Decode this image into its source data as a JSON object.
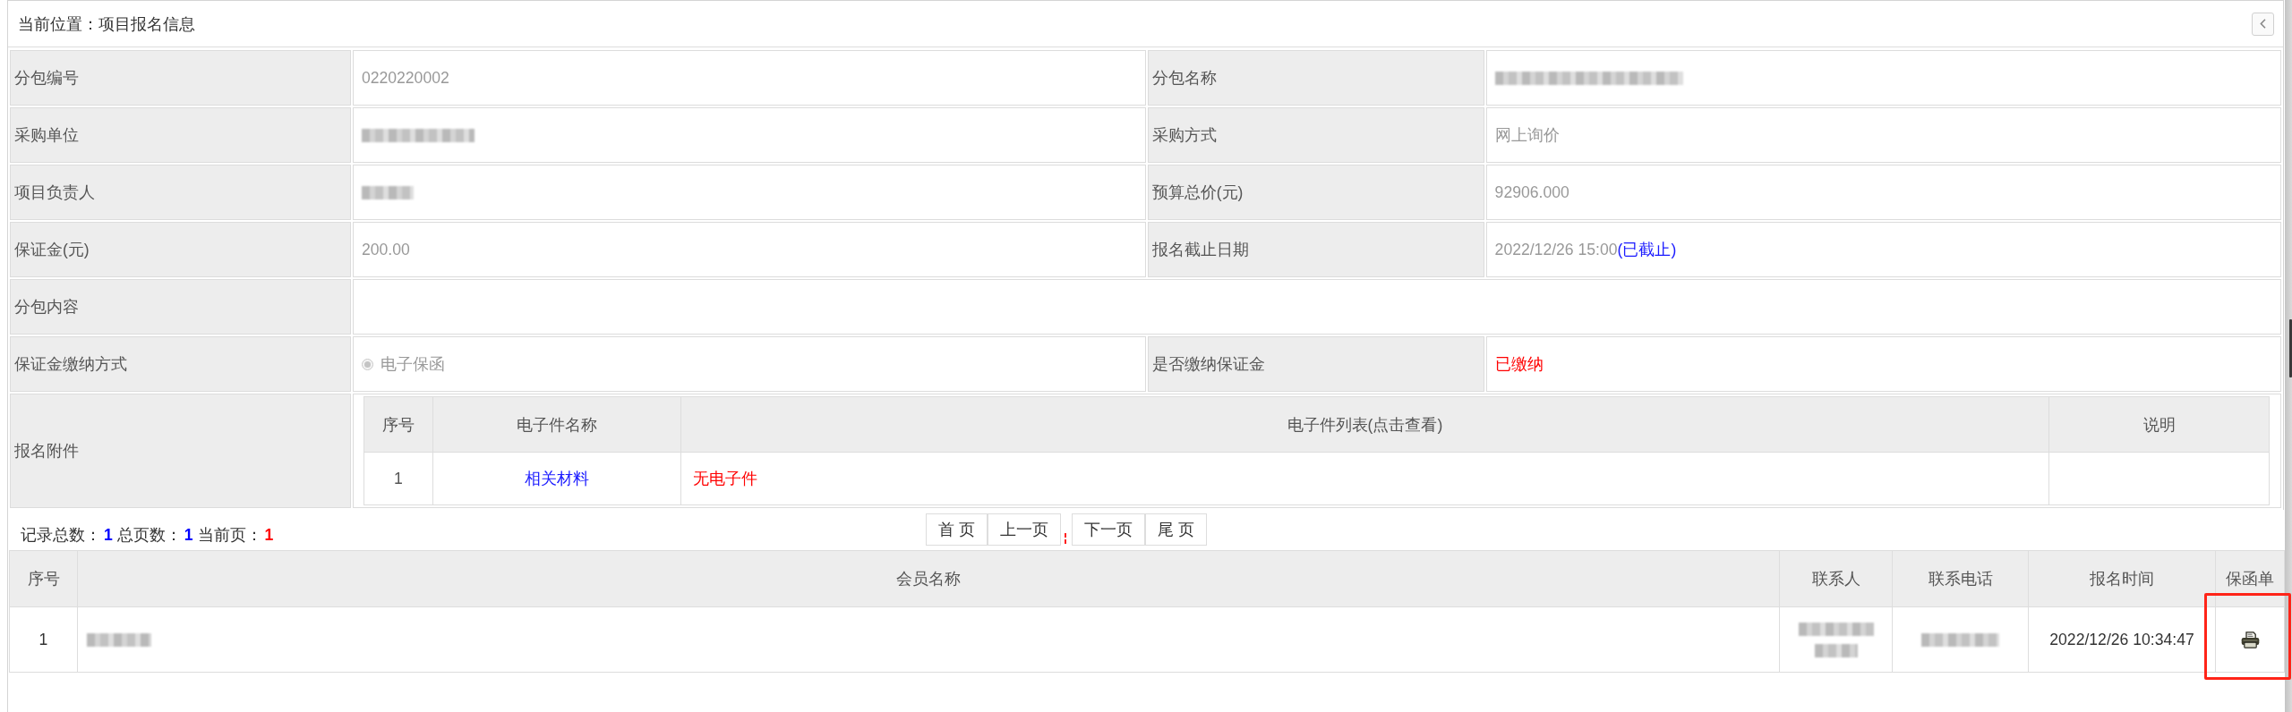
{
  "header": {
    "breadcrumb": "当前位置：项目报名信息"
  },
  "info_form": {
    "rows": [
      {
        "fields": [
          {
            "label": "分包编号",
            "kind": "text",
            "value": "0220220002"
          },
          {
            "label": "分包名称",
            "kind": "redacted"
          }
        ]
      },
      {
        "fields": [
          {
            "label": "采购单位",
            "kind": "redacted"
          },
          {
            "label": "采购方式",
            "kind": "text",
            "value": "网上询价"
          }
        ]
      },
      {
        "fields": [
          {
            "label": "项目负责人",
            "kind": "redacted"
          },
          {
            "label": "预算总价(元)",
            "kind": "text",
            "value": "92906.000"
          }
        ]
      },
      {
        "fields": [
          {
            "label": "保证金(元)",
            "kind": "text",
            "value": "200.00"
          },
          {
            "label": "报名截止日期",
            "kind": "text",
            "value": "2022/12/26 15:00",
            "status": "(已截止)"
          }
        ]
      },
      {
        "fields": [
          {
            "label": "分包内容",
            "kind": "blank"
          }
        ]
      },
      {
        "fields": [
          {
            "label": "保证金缴纳方式",
            "kind": "radio",
            "options": [
              {
                "label": "电子保函",
                "selected": true,
                "disabled": true
              }
            ]
          },
          {
            "label": "是否缴纳保证金",
            "kind": "alert",
            "value": "已缴纳"
          }
        ]
      },
      {
        "fields": [
          {
            "label": "报名附件",
            "kind": "attachments",
            "columns": [
              "序号",
              "电子件名称",
              "电子件列表(点击查看)",
              "说明"
            ],
            "rows": [
              {
                "index": "1",
                "name": "相关材料",
                "files": "无电子件"
              }
            ]
          }
        ]
      }
    ]
  },
  "pager": {
    "stats": [
      {
        "label": "记录总数：",
        "value": "1",
        "color": "#0000ff"
      },
      {
        "label": "总页数：",
        "value": "1",
        "color": "#0000ff"
      },
      {
        "label": "当前页：",
        "value": "1",
        "color": "#ff0000"
      }
    ],
    "buttons": [
      "首 页",
      "上一页",
      "下一页",
      "尾 页"
    ]
  },
  "signup_table": {
    "columns": [
      "序号",
      "会员名称",
      "联系人",
      "联系电话",
      "报名时间",
      "保函单"
    ],
    "rows": [
      {
        "cells": [
          {
            "kind": "text",
            "text": "1"
          },
          {
            "kind": "redacted"
          },
          {
            "kind": "redacted_two_lines"
          },
          {
            "kind": "redacted"
          },
          {
            "kind": "text",
            "text": "2022/12/26 10:34:47"
          },
          {
            "kind": "print",
            "highlighted": true
          }
        ]
      }
    ]
  }
}
